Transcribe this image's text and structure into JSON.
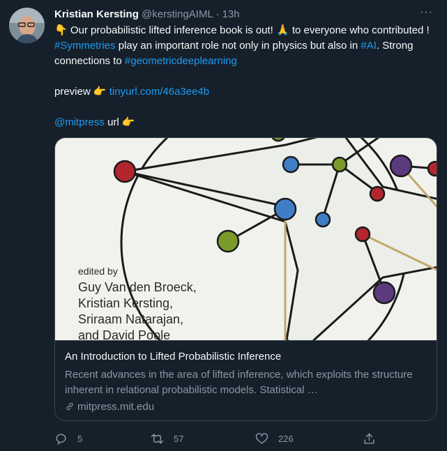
{
  "tweet": {
    "author_name": "Kristian Kersting",
    "handle": "@kerstingAIML",
    "separator": "·",
    "time": "13h",
    "more": "···",
    "line1_emoji": "👇",
    "line1_text": " Our probabilistic lifted inference book is out! ",
    "line1_emoji2": "🙏",
    "line1_text2": " to everyone who contributed ! ",
    "hashtag_symmetries": "#Symmetries",
    "text_mid": " play an important role not only in physics but also in ",
    "hashtag_ai": "#AI",
    "text_strong": ". Strong connections to ",
    "hashtag_gdl": "#geometricdeeplearning",
    "preview_label": "preview ",
    "pointing_emoji": "👉",
    "preview_link": "tinyurl.com/46a3ee4b",
    "mention": "@mitpress",
    "url_label": " url ",
    "pointing_emoji2": "👉"
  },
  "card": {
    "edited_by": "edited by",
    "editors": [
      "Guy Van den Broeck,",
      "Kristian Kersting,",
      "Sriraam Natarajan,",
      "and David Poole"
    ],
    "title": "An Introduction to Lifted Probabilistic Inference",
    "description": "Recent advances in the area of lifted inference, which exploits the structure inherent in relational probabilistic models. Statistical …",
    "domain": "mitpress.mit.edu",
    "colors": {
      "red": "#b3262d",
      "blue": "#3f7dc7",
      "green": "#7a9a2a",
      "purple": "#5b3a7e",
      "line": "#1a1a1a"
    }
  },
  "actions": {
    "reply_count": "5",
    "retweet_count": "57",
    "like_count": "226",
    "share_icon": "share-icon"
  }
}
